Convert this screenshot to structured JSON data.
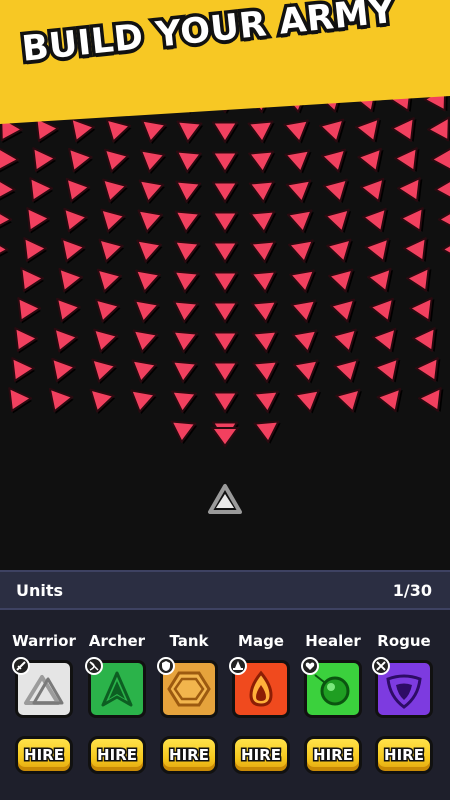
{
  "banner": {
    "title": "BUILD YOUR ARMY",
    "color": "#f7c824"
  },
  "game": {
    "enemy_color": "#f2405f",
    "player_unit": "triangle-ship-icon"
  },
  "units_panel": {
    "label": "Units",
    "count": "1/30",
    "units": [
      {
        "name": "Warrior",
        "icon": "warrior-triangle-icon",
        "badge_icon": "sword-icon",
        "color": "#e5e5e5",
        "hire_label": "HIRE"
      },
      {
        "name": "Archer",
        "icon": "archer-arrow-icon",
        "badge_icon": "bow-icon",
        "color": "#2bb34a",
        "hire_label": "HIRE"
      },
      {
        "name": "Tank",
        "icon": "tank-hexagon-icon",
        "badge_icon": "shield-icon",
        "color": "#e6a33c",
        "hire_label": "HIRE"
      },
      {
        "name": "Mage",
        "icon": "mage-flame-icon",
        "badge_icon": "wizard-hat-icon",
        "color": "#f04a1e",
        "hire_label": "HIRE"
      },
      {
        "name": "Healer",
        "icon": "healer-orb-icon",
        "badge_icon": "heart-icon",
        "color": "#3bd13d",
        "hire_label": "HIRE"
      },
      {
        "name": "Rogue",
        "icon": "rogue-blade-icon",
        "badge_icon": "crossed-daggers-icon",
        "color": "#7d3be0",
        "hire_label": "HIRE"
      }
    ]
  }
}
